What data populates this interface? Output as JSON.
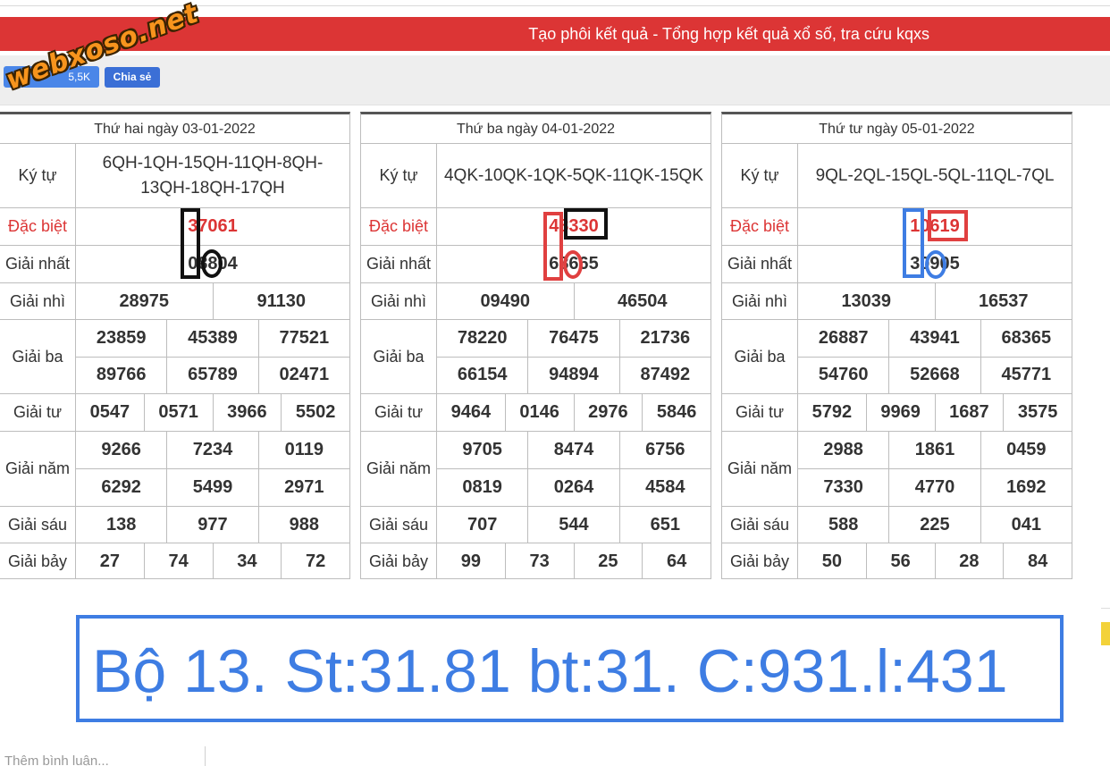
{
  "header": {
    "title": "Tạo phôi kết quả - Tổng hợp kết quả xổ số, tra cứu kqxs",
    "logo_text": "webxoso.net"
  },
  "social": {
    "like_count": "5,5K",
    "share_label": "Chia sẻ"
  },
  "labels": {
    "kytu": "Ký tự",
    "db": "Đặc biệt",
    "g1": "Giải nhất",
    "g2": "Giải nhì",
    "g3": "Giải ba",
    "g4": "Giải tư",
    "g5": "Giải năm",
    "g6": "Giải sáu",
    "g7": "Giải bảy"
  },
  "panels": [
    {
      "date": "Thứ hai ngày 03-01-2022",
      "kytu": "6QH-1QH-15QH-11QH-8QH-13QH-18QH-17QH",
      "db": "37061",
      "g1": "08804",
      "g2": [
        "28975",
        "91130"
      ],
      "g3": [
        "23859",
        "45389",
        "77521",
        "89766",
        "65789",
        "02471"
      ],
      "g4": [
        "0547",
        "0571",
        "3966",
        "5502"
      ],
      "g5": [
        "9266",
        "7234",
        "0119",
        "6292",
        "5499",
        "2971"
      ],
      "g6": [
        "138",
        "977",
        "988"
      ],
      "g7": [
        "27",
        "74",
        "34",
        "72"
      ]
    },
    {
      "date": "Thứ ba ngày 04-01-2022",
      "kytu": "4QK-10QK-1QK-5QK-11QK-15QK",
      "db": "48330",
      "g1": "68665",
      "g2": [
        "09490",
        "46504"
      ],
      "g3": [
        "78220",
        "76475",
        "21736",
        "66154",
        "94894",
        "87492"
      ],
      "g4": [
        "9464",
        "0146",
        "2976",
        "5846"
      ],
      "g5": [
        "9705",
        "8474",
        "6756",
        "0819",
        "0264",
        "4584"
      ],
      "g6": [
        "707",
        "544",
        "651"
      ],
      "g7": [
        "99",
        "73",
        "25",
        "64"
      ]
    },
    {
      "date": "Thứ tư ngày 05-01-2022",
      "kytu": "9QL-2QL-15QL-5QL-11QL-7QL",
      "db": "10619",
      "g1": "30905",
      "g2": [
        "13039",
        "16537"
      ],
      "g3": [
        "26887",
        "43941",
        "68365",
        "54760",
        "52668",
        "45771"
      ],
      "g4": [
        "5792",
        "9969",
        "1687",
        "3575"
      ],
      "g5": [
        "2988",
        "1861",
        "0459",
        "7330",
        "4770",
        "1692"
      ],
      "g6": [
        "588",
        "225",
        "041"
      ],
      "g7": [
        "50",
        "56",
        "28",
        "84"
      ]
    }
  ],
  "annotation": {
    "text": "Bộ 13. St:31.81 bt:31. C:931.l:431"
  },
  "comment": {
    "placeholder": "Thêm bình luận..."
  },
  "colors": {
    "header_red": "#dc3535",
    "annotation_blue": "#3e7de3",
    "like_blue": "#4a86e8",
    "logo_orange": "#f7941d"
  }
}
